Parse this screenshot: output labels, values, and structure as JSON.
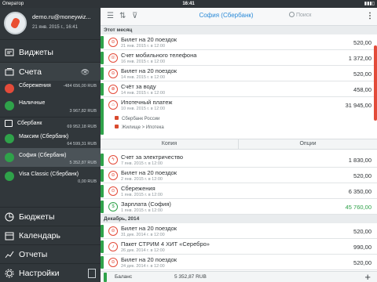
{
  "status": {
    "carrier": "Оператор",
    "time": "16:41",
    "battery": "🔋"
  },
  "profile": {
    "email": "demo.ru@moneywiz...",
    "date": "21 янв. 2015 г., 16:41",
    "menu": "•••"
  },
  "sidebar": {
    "widgets": "Виджеты",
    "accounts": "Счета",
    "accounts_eye": "👁",
    "items": [
      {
        "name": "Сбережения",
        "balance": "-484 656,00 RUB",
        "color": "#e34b3a"
      },
      {
        "name": "Наличные",
        "balance": "3 967,82 RUB",
        "color": "#2fa24a"
      }
    ],
    "group": {
      "name": "Сбербанк",
      "balance": "69 952,18 RUB"
    },
    "group_items": [
      {
        "name": "Максим (Сбербанк)",
        "balance": "64 599,31 RUB",
        "color": "#2fa24a"
      },
      {
        "name": "София (Сбербанк)",
        "balance": "5 352,87 RUB",
        "color": "#2fa24a"
      },
      {
        "name": "Visa Classic (Сбербанк)",
        "balance": "0,00 RUB",
        "color": "#2fa24a"
      }
    ],
    "budgets": "Бюджеты",
    "calendar": "Календарь",
    "reports": "Отчеты",
    "settings": "Настройки"
  },
  "toolbar": {
    "title": "София (Сбербанк)",
    "search_placeholder": "Поиск",
    "more": "⋮"
  },
  "sections": {
    "this_month": "Этот месяц",
    "december": "Декабрь, 2014"
  },
  "transactions_this_month": [
    {
      "title": "Билет на 20 поездок",
      "date": "21 янв. 2015 г. в 12:00",
      "amount": "520,00",
      "kind": "expense",
      "icon": "⊝"
    },
    {
      "title": "Счет мобильного телефона",
      "date": "16 янв. 2015 г. в 12:00",
      "amount": "1 372,00",
      "kind": "expense",
      "icon": "☏"
    },
    {
      "title": "Билет на 20 поездок",
      "date": "14 янв. 2015 г. в 12:00",
      "amount": "520,00",
      "kind": "expense",
      "icon": "⊝"
    },
    {
      "title": "Счёт за воду",
      "date": "14 янв. 2015 г. в 12:00",
      "amount": "458,00",
      "kind": "expense",
      "icon": "⊕"
    }
  ],
  "expanded": {
    "title": "Ипотечный платеж",
    "date": "10 янв. 2015 г. в 12:00",
    "amount": "31 945,00",
    "payee": "Сбербанк России",
    "category": "Жилище > Ипотека",
    "icon": "⌂"
  },
  "actions": {
    "copy": "Копия",
    "options": "Опции"
  },
  "transactions_after": [
    {
      "title": "Счет за электричество",
      "date": "7 янв. 2015 г. в 12:00",
      "amount": "1 830,00",
      "kind": "expense",
      "icon": "ϟ"
    },
    {
      "title": "Билет на 20 поездок",
      "date": "2 янв. 2015 г. в 12:00",
      "amount": "520,00",
      "kind": "expense",
      "icon": "⊝"
    },
    {
      "title": "Сбережения",
      "date": "1 янв. 2015 г. в 12:00",
      "amount": "6 350,00",
      "kind": "expense",
      "icon": "⊙"
    },
    {
      "title": "Зарплата (София)",
      "date": "1 янв. 2015 г. в 12:00",
      "amount": "45 760,00",
      "kind": "income",
      "icon": "$"
    }
  ],
  "transactions_december": [
    {
      "title": "Билет на 20 поездок",
      "date": "31 дек. 2014 г. в 12:00",
      "amount": "520,00",
      "kind": "expense",
      "icon": "⊝"
    },
    {
      "title": "Пакет СТРИМ 4 ХИТ «Серебро»",
      "date": "26 дек. 2014 г. в 12:00",
      "amount": "990,00",
      "kind": "expense",
      "icon": "♪"
    },
    {
      "title": "Билет на 20 поездок",
      "date": "24 дек. 2014 г. в 12:00",
      "amount": "520,00",
      "kind": "expense",
      "icon": "⊝"
    }
  ],
  "footer": {
    "label": "Баланс",
    "value": "5 352,87 RUB",
    "add": "+"
  },
  "colors": {
    "expense": "#e34b3a",
    "income": "#2fa24a",
    "accent": "#2a8ad8"
  }
}
